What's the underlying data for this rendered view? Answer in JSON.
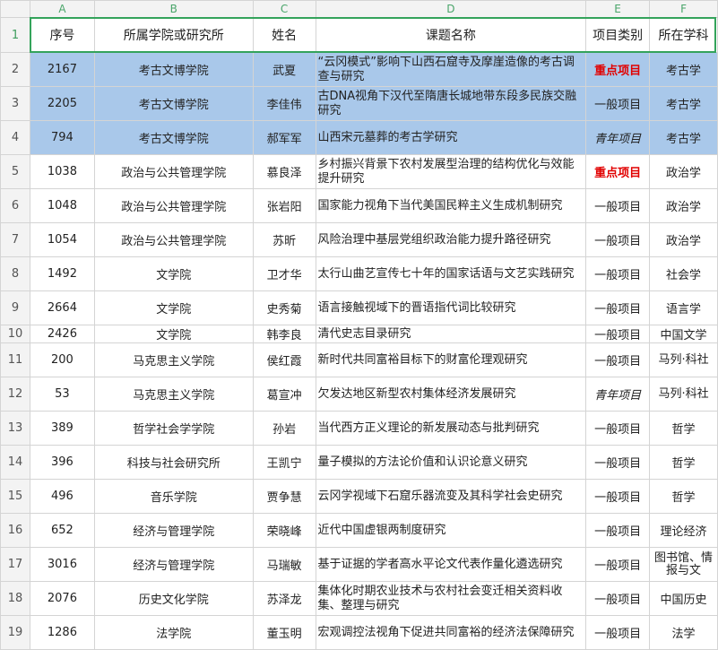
{
  "columns": [
    "A",
    "B",
    "C",
    "D",
    "E",
    "F"
  ],
  "header": {
    "row_number": "1",
    "cells": [
      "序号",
      "所属学院或研究所",
      "姓名",
      "课题名称",
      "项目类别",
      "所在学科"
    ]
  },
  "rows": [
    {
      "rn": "2",
      "no": "2167",
      "school": "考古文博学院",
      "name": "武夏",
      "title": "“云冈模式”影响下山西石窟寺及摩崖造像的考古调查与研究",
      "type": "重点项目",
      "subject": "考古学"
    },
    {
      "rn": "3",
      "no": "2205",
      "school": "考古文博学院",
      "name": "李佳伟",
      "title": "古DNA视角下汉代至隋唐长城地带东段多民族交融研究",
      "type": "一般项目",
      "subject": "考古学"
    },
    {
      "rn": "4",
      "no": "794",
      "school": "考古文博学院",
      "name": "郝军军",
      "title": "山西宋元墓葬的考古学研究",
      "type": "青年项目",
      "subject": "考古学"
    },
    {
      "rn": "5",
      "no": "1038",
      "school": "政治与公共管理学院",
      "name": "慕良泽",
      "title": "乡村振兴背景下农村发展型治理的结构优化与效能提升研究",
      "type": "重点项目",
      "subject": "政治学"
    },
    {
      "rn": "6",
      "no": "1048",
      "school": "政治与公共管理学院",
      "name": "张岩阳",
      "title": "国家能力视角下当代美国民粹主义生成机制研究",
      "type": "一般项目",
      "subject": "政治学"
    },
    {
      "rn": "7",
      "no": "1054",
      "school": "政治与公共管理学院",
      "name": "苏昕",
      "title": "风险治理中基层党组织政治能力提升路径研究",
      "type": "一般项目",
      "subject": "政治学"
    },
    {
      "rn": "8",
      "no": "1492",
      "school": "文学院",
      "name": "卫才华",
      "title": "太行山曲艺宣传七十年的国家话语与文艺实践研究",
      "type": "一般项目",
      "subject": "社会学"
    },
    {
      "rn": "9",
      "no": "2664",
      "school": "文学院",
      "name": "史秀菊",
      "title": "语言接触视域下的晋语指代词比较研究",
      "type": "一般项目",
      "subject": "语言学"
    },
    {
      "rn": "10",
      "no": "2426",
      "school": "文学院",
      "name": "韩李良",
      "title": "清代史志目录研究",
      "type": "一般项目",
      "subject": "中国文学"
    },
    {
      "rn": "11",
      "no": "200",
      "school": "马克思主义学院",
      "name": "侯红霞",
      "title": "新时代共同富裕目标下的财富伦理观研究",
      "type": "一般项目",
      "subject": "马列·科社"
    },
    {
      "rn": "12",
      "no": "53",
      "school": "马克思主义学院",
      "name": "葛宣冲",
      "title": "欠发达地区新型农村集体经济发展研究",
      "type": "青年项目",
      "subject": "马列·科社"
    },
    {
      "rn": "13",
      "no": "389",
      "school": "哲学社会学学院",
      "name": "孙岩",
      "title": "当代西方正义理论的新发展动态与批判研究",
      "type": "一般项目",
      "subject": "哲学"
    },
    {
      "rn": "14",
      "no": "396",
      "school": "科技与社会研究所",
      "name": "王凯宁",
      "title": "量子模拟的方法论价值和认识论意义研究",
      "type": "一般项目",
      "subject": "哲学"
    },
    {
      "rn": "15",
      "no": "496",
      "school": "音乐学院",
      "name": "贾争慧",
      "title": "云冈学视域下石窟乐器流变及其科学社会史研究",
      "type": "一般项目",
      "subject": "哲学"
    },
    {
      "rn": "16",
      "no": "652",
      "school": "经济与管理学院",
      "name": "荣晓峰",
      "title": "近代中国虚银两制度研究",
      "type": "一般项目",
      "subject": "理论经济"
    },
    {
      "rn": "17",
      "no": "3016",
      "school": "经济与管理学院",
      "name": "马瑞敏",
      "title": "基于证据的学者高水平论文代表作量化遴选研究",
      "type": "一般项目",
      "subject": "图书馆、情报与文"
    },
    {
      "rn": "18",
      "no": "2076",
      "school": "历史文化学院",
      "name": "苏泽龙",
      "title": "集体化时期农业技术与农村社会变迁相关资料收集、整理与研究",
      "type": "一般项目",
      "subject": "中国历史"
    },
    {
      "rn": "19",
      "no": "1286",
      "school": "法学院",
      "name": "董玉明",
      "title": "宏观调控法视角下促进共同富裕的经济法保障研究",
      "type": "一般项目",
      "subject": "法学"
    }
  ],
  "colors": {
    "selection": "#34a35b",
    "highlight": "#a9c8ea",
    "key_project": "#e10000",
    "header_letters": "#4aa56a"
  }
}
